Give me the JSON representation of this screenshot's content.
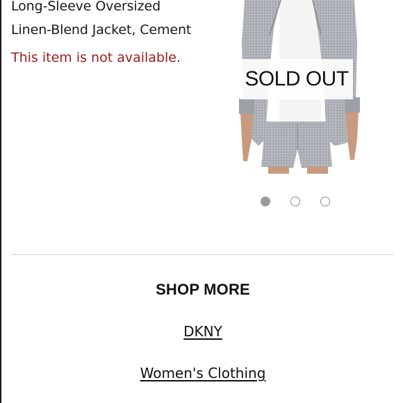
{
  "product": {
    "title_line1": "Long-Sleeve Oversized",
    "title_line2": "Linen-Blend Jacket, Cement",
    "availability": "This item is not available.",
    "sold_out_label": "SOLD OUT"
  },
  "carousel": {
    "total": 3,
    "active_index": 1
  },
  "shop_more": {
    "heading": "SHOP MORE",
    "links": [
      "DKNY",
      "Women's Clothing"
    ]
  },
  "colors": {
    "availability_text": "#9b1b1b",
    "jacket": "#a9adb3",
    "dot_active": "#9a9a9a"
  }
}
